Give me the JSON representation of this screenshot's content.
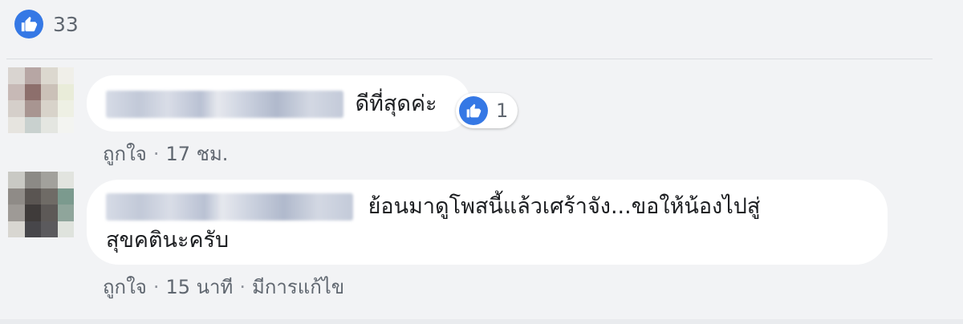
{
  "post": {
    "like_count": "33",
    "like_icon": "thumbs-up-icon"
  },
  "comments": [
    {
      "text": "ดีที่สุดค่ะ",
      "like_count": "1",
      "action_like": "ถูกใจ",
      "separator": "·",
      "time": "17 ชม."
    },
    {
      "text_line1": "ย้อนมาดูโพสนี้แล้วเศร้าจัง...ขอให้น้องไปสู่",
      "text_line2": "สุขคตินะครับ",
      "action_like": "ถูกใจ",
      "separator": "·",
      "time": "15 นาที",
      "edited": "มีการแก้ไข"
    }
  ],
  "colors": {
    "like_blue": "#3578e5",
    "background": "#f2f3f5",
    "bubble": "#ffffff",
    "meta_text": "#606770"
  }
}
